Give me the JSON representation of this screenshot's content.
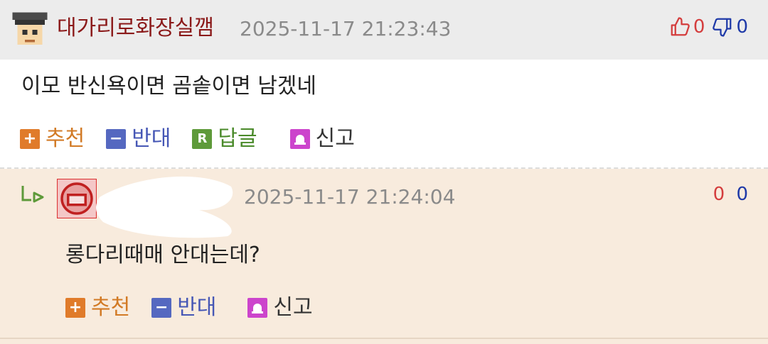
{
  "main_comment": {
    "author": "대가리로화장실깸",
    "date": "2025-11-17 21:23:43",
    "upvotes": "0",
    "downvotes": "0",
    "body": "이모 반신욕이면 곰솥이면 남겠네",
    "actions": {
      "recommend": "추천",
      "oppose": "반대",
      "reply": "답글",
      "report": "신고"
    },
    "reply_icon_letter": "R"
  },
  "reply_comment": {
    "date": "2025-11-17 21:24:04",
    "upvotes": "0",
    "downvotes": "0",
    "body": "롱다리때매 안대는데?",
    "actions": {
      "recommend": "추천",
      "oppose": "반대",
      "report": "신고"
    }
  },
  "colors": {
    "author": "#8b1a1a",
    "upvote": "#d43d3d",
    "downvote": "#1f3aa8",
    "reply_bg": "#f8ebdd"
  }
}
